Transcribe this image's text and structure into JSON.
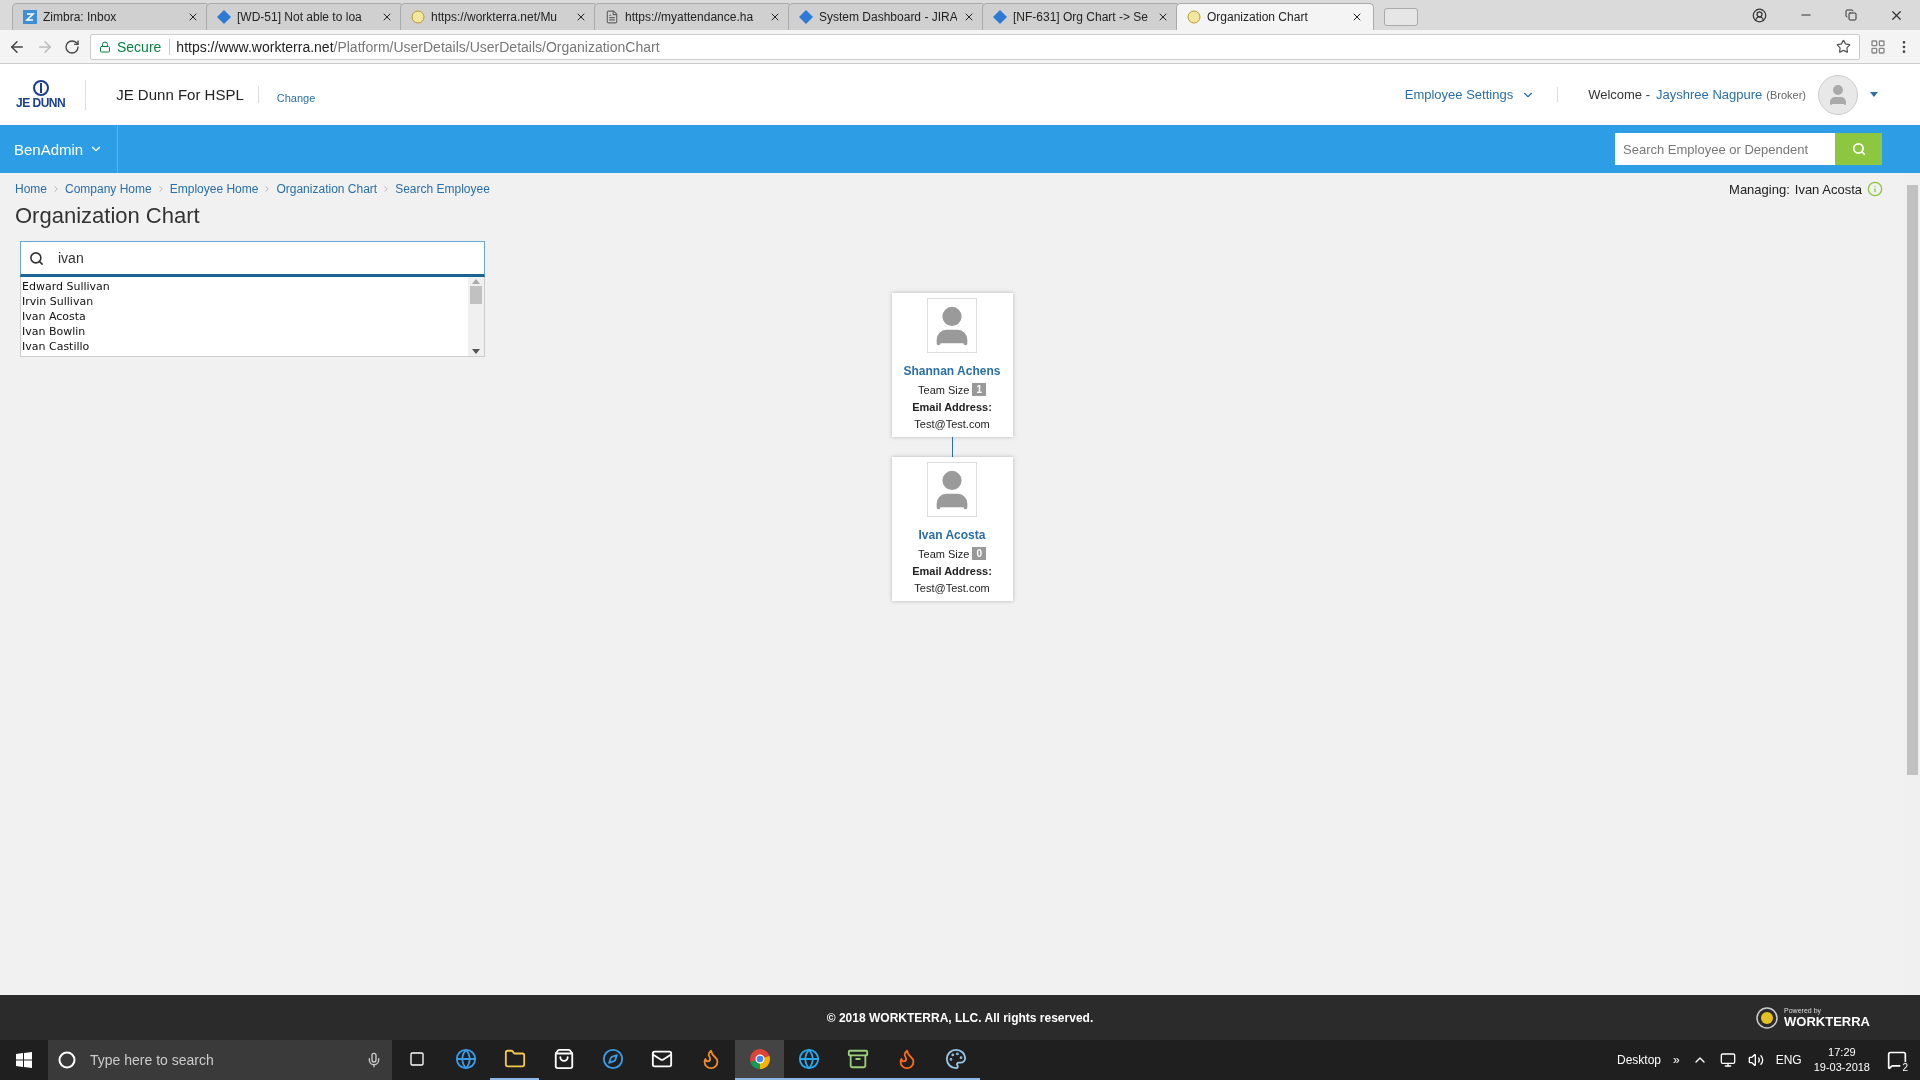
{
  "browser": {
    "tabs": [
      {
        "title": "Zimbra: Inbox",
        "kind": "zimbra",
        "selected": false
      },
      {
        "title": "[WD-51] Not able to loa",
        "kind": "jira",
        "selected": false
      },
      {
        "title": "https://workterra.net/Mu",
        "kind": "globe",
        "selected": false
      },
      {
        "title": "https://myattendance.ha",
        "kind": "page",
        "selected": false
      },
      {
        "title": "System Dashboard - JIRA",
        "kind": "jira",
        "selected": false
      },
      {
        "title": "[NF-631] Org Chart -> Se",
        "kind": "jira",
        "selected": false
      },
      {
        "title": "Organization Chart",
        "kind": "globe",
        "selected": true
      }
    ],
    "secure_label": "Secure",
    "url_host": "https://www.workterra.net",
    "url_path": "/Platform/UserDetails/UserDetails/OrganizationChart"
  },
  "header": {
    "logo_text": "JE DUNN",
    "company": "JE Dunn For HSPL",
    "change_link": "Change",
    "settings_menu": "Employee Settings",
    "welcome_label": "Welcome -",
    "user_name": "Jayshree Nagpure",
    "user_role": "(Broker)"
  },
  "navbar": {
    "menu": "BenAdmin",
    "search_placeholder": "Search Employee or Dependent"
  },
  "breadcrumbs": [
    "Home",
    "Company Home",
    "Employee Home",
    "Organization Chart",
    "Search Employee"
  ],
  "managing": {
    "label": "Managing:",
    "name": "Ivan Acosta"
  },
  "page_title": "Organization Chart",
  "employee_search": {
    "value": "ivan",
    "results": [
      "Edward Sullivan",
      "Irvin Sullivan",
      "Ivan Acosta",
      "Ivan Bowlin",
      "Ivan Castillo"
    ]
  },
  "org_chart": [
    {
      "name": "Shannan Achens",
      "team_size_label": "Team Size",
      "team_size": "1",
      "email_label": "Email Address:",
      "email": "Test@Test.com"
    },
    {
      "name": "Ivan Acosta",
      "team_size_label": "Team Size",
      "team_size": "0",
      "email_label": "Email Address:",
      "email": "Test@Test.com"
    }
  ],
  "footer": {
    "copyright": "© 2018 WORKTERRA, LLC. All rights reserved.",
    "powered_by": "Powered by",
    "brand": "WORKTERRA"
  },
  "taskbar": {
    "search_placeholder": "Type here to search",
    "apps": [
      {
        "kind": "edge",
        "running": false,
        "selected": false
      },
      {
        "kind": "folder",
        "running": true,
        "selected": false
      },
      {
        "kind": "store",
        "running": false,
        "selected": false
      },
      {
        "kind": "compass",
        "running": false,
        "selected": false
      },
      {
        "kind": "mail",
        "running": false,
        "selected": false
      },
      {
        "kind": "flame",
        "running": false,
        "selected": false
      },
      {
        "kind": "chrome",
        "running": true,
        "selected": true
      },
      {
        "kind": "ie",
        "running": true,
        "selected": false
      },
      {
        "kind": "archive",
        "running": true,
        "selected": false
      },
      {
        "kind": "firefox",
        "running": true,
        "selected": false
      },
      {
        "kind": "paint",
        "running": true,
        "selected": false
      }
    ],
    "desktop_label": "Desktop",
    "overflow_mark": "»",
    "language": "ENG",
    "time": "17:29",
    "date": "19-03-2018",
    "notification_count": "2"
  }
}
